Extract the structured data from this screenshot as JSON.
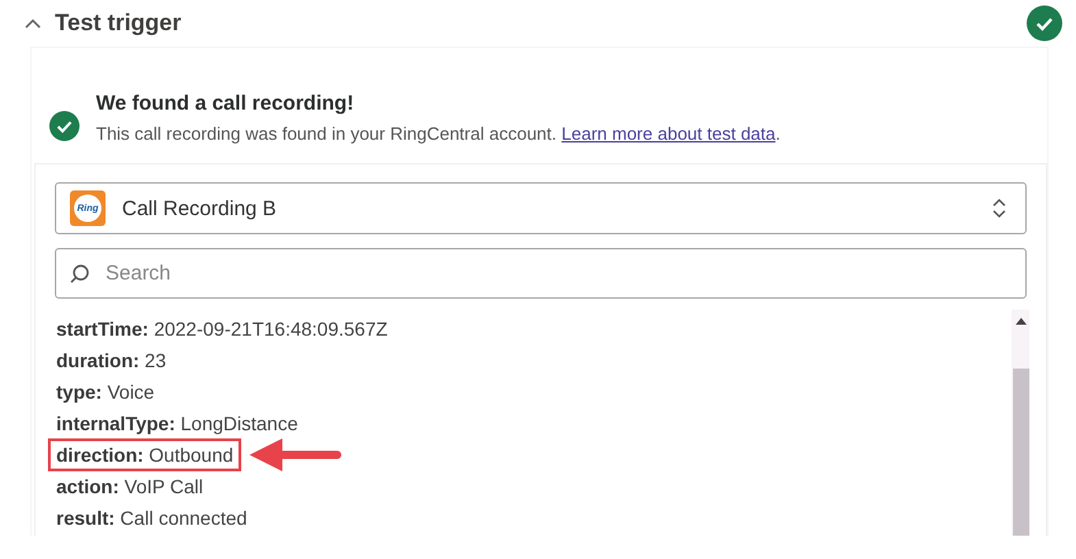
{
  "section": {
    "title": "Test trigger",
    "expanded": true,
    "complete": true
  },
  "message": {
    "title": "We found a call recording!",
    "text": "This call recording was found in your RingCentral account.",
    "link": "Learn more about test data",
    "trailing": "."
  },
  "record_select": {
    "value": "Call Recording B",
    "app_logo_text": "Ring"
  },
  "search": {
    "placeholder": "Search"
  },
  "fields": [
    {
      "key": "startTime:",
      "value": "2022-09-21T16:48:09.567Z",
      "highlighted": false
    },
    {
      "key": "duration:",
      "value": "23",
      "highlighted": false
    },
    {
      "key": "type:",
      "value": "Voice",
      "highlighted": false
    },
    {
      "key": "internalType:",
      "value": "LongDistance",
      "highlighted": false
    },
    {
      "key": "direction:",
      "value": "Outbound",
      "highlighted": true
    },
    {
      "key": "action:",
      "value": "VoIP Call",
      "highlighted": false
    },
    {
      "key": "result:",
      "value": "Call connected",
      "highlighted": false
    }
  ]
}
